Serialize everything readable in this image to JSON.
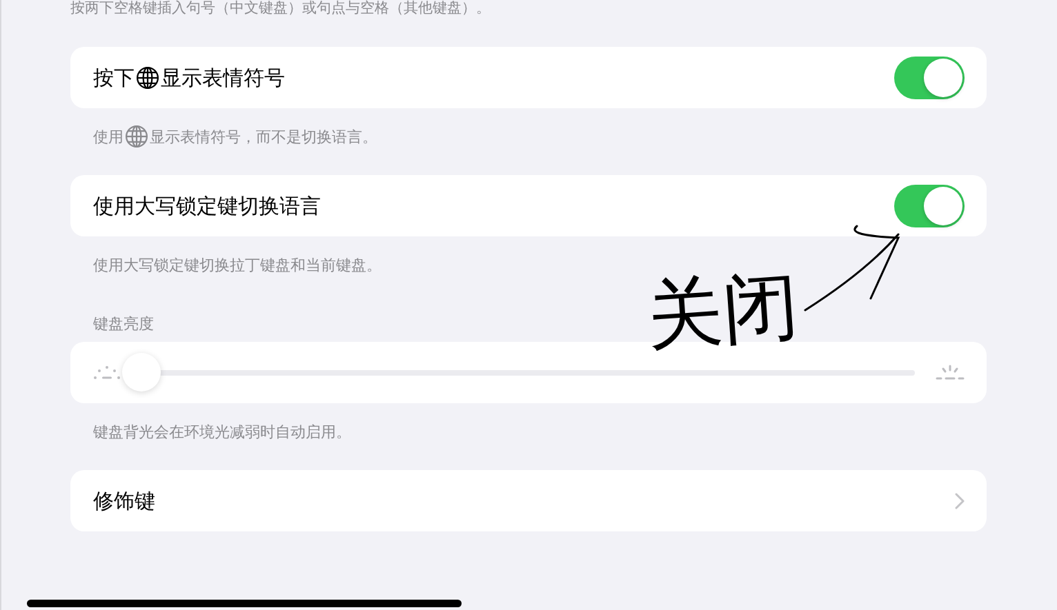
{
  "top_footer": "按两下空格键插入句号（中文键盘）或句点与空格（其他键盘）。",
  "toggles": [
    {
      "label_before": "按下",
      "label_after": "显示表情符号",
      "on": true,
      "footer_before": "使用",
      "footer_after": "显示表情符号，而不是切换语言。"
    },
    {
      "label": "使用大写锁定键切换语言",
      "on": true,
      "footer": "使用大写锁定键切换拉丁键盘和当前键盘。"
    }
  ],
  "brightness": {
    "header": "键盘亮度",
    "level": 0.0,
    "footer": "键盘背光会在环境光减弱时自动启用。"
  },
  "modifier_keys": {
    "label": "修饰键"
  },
  "annotation": {
    "text": "关闭"
  }
}
